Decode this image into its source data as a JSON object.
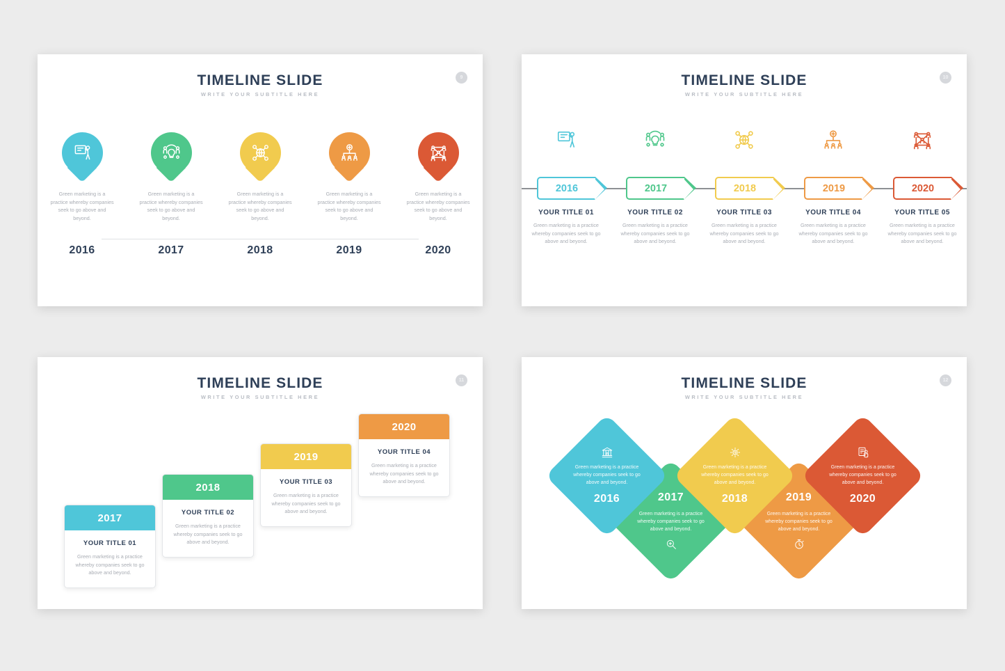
{
  "common": {
    "title": "TIMELINE SLIDE",
    "subtitle": "WRITE YOUR SUBTITLE HERE",
    "body_text": "Green marketing is a practice whereby companies seek to go above and beyond.",
    "colors": {
      "cyan": "#4FC6D9",
      "green": "#4FC78B",
      "yellow": "#F1CB4E",
      "orange": "#EE9A45",
      "red": "#DB5935",
      "navy": "#2e3f57",
      "gray_text": "#a9adb4",
      "page_bg": "#ececec",
      "slide_bg": "#ffffff"
    }
  },
  "slide1": {
    "page_number": "9",
    "pins": [
      {
        "year": "2016",
        "color": "#4FC6D9",
        "icon": "presenter-board-icon",
        "text": "Green marketing is a practice whereby companies seek to go above and beyond."
      },
      {
        "year": "2017",
        "color": "#4FC78B",
        "icon": "lightbulb-team-icon",
        "text": "Green marketing is a practice whereby companies seek to go above and beyond."
      },
      {
        "year": "2018",
        "color": "#F1CB4E",
        "icon": "globe-network-icon",
        "text": "Green marketing is a practice whereby companies seek to go above and beyond."
      },
      {
        "year": "2019",
        "color": "#EE9A45",
        "icon": "add-user-hierarchy-icon",
        "text": "Green marketing is a practice whereby companies seek to go above and beyond."
      },
      {
        "year": "2020",
        "color": "#DB5935",
        "icon": "people-network-icon",
        "text": "Green marketing is a practice whereby companies seek to go above and beyond."
      }
    ]
  },
  "slide2": {
    "page_number": "10",
    "items": [
      {
        "year": "2016",
        "color": "#4FC6D9",
        "icon": "presenter-board-icon",
        "title": "YOUR TITLE 01",
        "text": "Green marketing is a practice whereby companies seek to go above and beyond."
      },
      {
        "year": "2017",
        "color": "#4FC78B",
        "icon": "lightbulb-team-icon",
        "title": "YOUR TITLE 02",
        "text": "Green marketing is a practice whereby companies seek to go above and beyond."
      },
      {
        "year": "2018",
        "color": "#F1CB4E",
        "icon": "globe-network-icon",
        "title": "YOUR TITLE 03",
        "text": "Green marketing is a practice whereby companies seek to go above and beyond."
      },
      {
        "year": "2019",
        "color": "#EE9A45",
        "icon": "add-user-hierarchy-icon",
        "title": "YOUR TITLE 04",
        "text": "Green marketing is a practice whereby companies seek to go above and beyond."
      },
      {
        "year": "2020",
        "color": "#DB5935",
        "icon": "people-network-icon",
        "title": "YOUR TITLE 05",
        "text": "Green marketing is a practice whereby companies seek to go above and beyond."
      }
    ]
  },
  "slide3": {
    "page_number": "11",
    "cards": [
      {
        "year": "2017",
        "color": "#4FC6D9",
        "title": "YOUR TITLE 01",
        "text": "Green marketing is a practice whereby companies seek to go above and beyond."
      },
      {
        "year": "2018",
        "color": "#4FC78B",
        "title": "YOUR TITLE 02",
        "text": "Green marketing is a practice whereby companies seek to go above and beyond."
      },
      {
        "year": "2019",
        "color": "#F1CB4E",
        "title": "YOUR TITLE 03",
        "text": "Green marketing is a practice whereby companies seek to go above and beyond."
      },
      {
        "year": "2020",
        "color": "#EE9A45",
        "title": "YOUR TITLE 04",
        "text": "Green marketing is a practice whereby companies seek to go above and beyond."
      }
    ]
  },
  "slide4": {
    "page_number": "12",
    "diamonds": [
      {
        "year": "2016",
        "color": "#4FC6D9",
        "icon": "bank-building-icon",
        "position": "up",
        "text": "Green marketing is a practice whereby companies seek to go above and beyond."
      },
      {
        "year": "2017",
        "color": "#4FC78B",
        "icon": "magnifier-icon",
        "position": "down",
        "text": "Green marketing is a practice whereby companies seek to go above and beyond."
      },
      {
        "year": "2018",
        "color": "#F1CB4E",
        "icon": "gear-idea-icon",
        "position": "up",
        "text": "Green marketing is a practice whereby companies seek to go above and beyond."
      },
      {
        "year": "2019",
        "color": "#EE9A45",
        "icon": "stopwatch-icon",
        "position": "down",
        "text": "Green marketing is a practice whereby companies seek to go above and beyond."
      },
      {
        "year": "2020",
        "color": "#DB5935",
        "icon": "hand-document-icon",
        "position": "up",
        "text": "Green marketing is a practice whereby companies seek to go above and beyond."
      }
    ]
  }
}
